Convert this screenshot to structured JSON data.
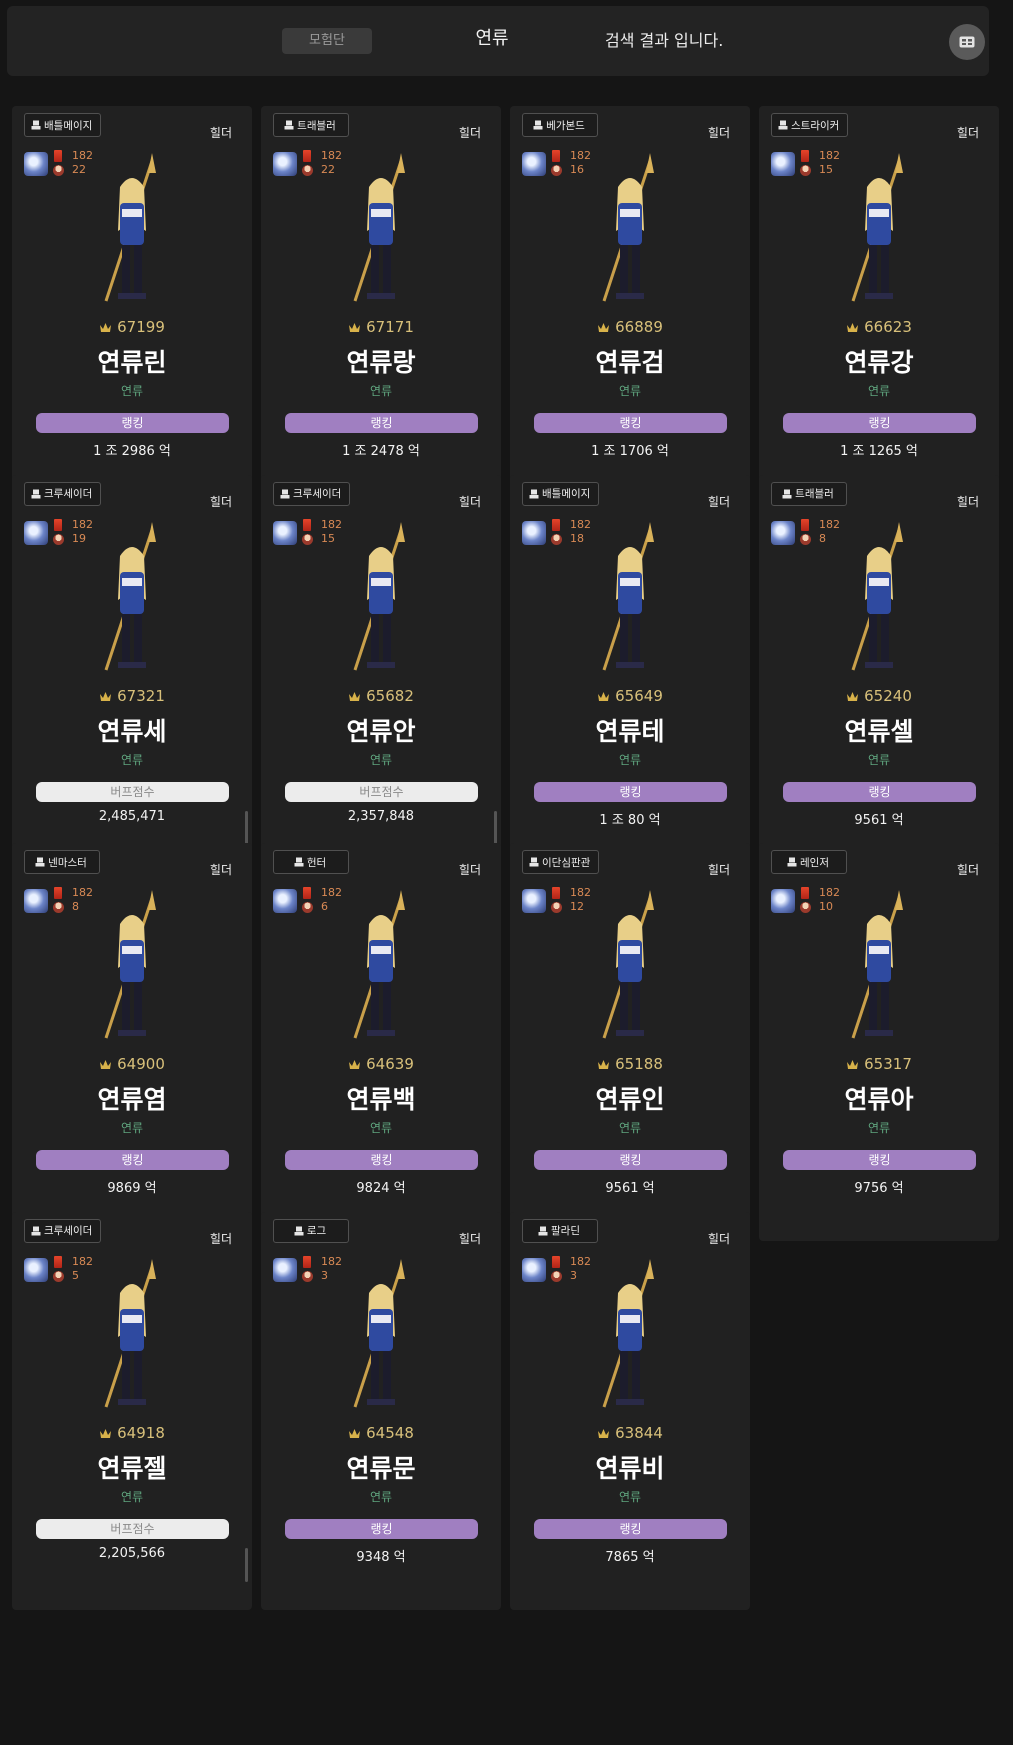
{
  "header": {
    "tab_label": "모험단",
    "search_name": "연류",
    "result_text": "검색 결과 입니다."
  },
  "colors": {
    "background": "#151515",
    "card": "#212121",
    "rank_pill": "#a07fc1",
    "buff_pill": "#ececec",
    "adventure_name": "#5fa57e",
    "fame": "#d8c07a",
    "level": "#d98a55"
  },
  "cards": [
    {
      "class_name": "배틀메이지",
      "guild": "힐더",
      "level": "182",
      "sub": "22",
      "fame": "67199",
      "name": "연류린",
      "adventure": "연류",
      "pill_type": "rank",
      "pill_label": "랭킹",
      "stat": "1 조 2986 억"
    },
    {
      "class_name": "트래블러",
      "guild": "힐더",
      "level": "182",
      "sub": "22",
      "fame": "67171",
      "name": "연류랑",
      "adventure": "연류",
      "pill_type": "rank",
      "pill_label": "랭킹",
      "stat": "1 조 2478 억"
    },
    {
      "class_name": "베가본드",
      "guild": "힐더",
      "level": "182",
      "sub": "16",
      "fame": "66889",
      "name": "연류검",
      "adventure": "연류",
      "pill_type": "rank",
      "pill_label": "랭킹",
      "stat": "1 조 1706 억"
    },
    {
      "class_name": "스트라이커",
      "guild": "힐더",
      "level": "182",
      "sub": "15",
      "fame": "66623",
      "name": "연류강",
      "adventure": "연류",
      "pill_type": "rank",
      "pill_label": "랭킹",
      "stat": "1 조 1265 억"
    },
    {
      "class_name": "크루세이더",
      "guild": "힐더",
      "level": "182",
      "sub": "19",
      "fame": "67321",
      "name": "연류세",
      "adventure": "연류",
      "pill_type": "buff",
      "pill_label": "버프점수",
      "stat": "2,485,471"
    },
    {
      "class_name": "크루세이더",
      "guild": "힐더",
      "level": "182",
      "sub": "15",
      "fame": "65682",
      "name": "연류안",
      "adventure": "연류",
      "pill_type": "buff",
      "pill_label": "버프점수",
      "stat": "2,357,848"
    },
    {
      "class_name": "배틀메이지",
      "guild": "힐더",
      "level": "182",
      "sub": "18",
      "fame": "65649",
      "name": "연류테",
      "adventure": "연류",
      "pill_type": "rank",
      "pill_label": "랭킹",
      "stat": "1 조 80 억"
    },
    {
      "class_name": "트래블러",
      "guild": "힐더",
      "level": "182",
      "sub": "8",
      "fame": "65240",
      "name": "연류셀",
      "adventure": "연류",
      "pill_type": "rank",
      "pill_label": "랭킹",
      "stat": "9561 억"
    },
    {
      "class_name": "넨마스터",
      "guild": "힐더",
      "level": "182",
      "sub": "8",
      "fame": "64900",
      "name": "연류염",
      "adventure": "연류",
      "pill_type": "rank",
      "pill_label": "랭킹",
      "stat": "9869 억"
    },
    {
      "class_name": "헌터",
      "guild": "힐더",
      "level": "182",
      "sub": "6",
      "fame": "64639",
      "name": "연류백",
      "adventure": "연류",
      "pill_type": "rank",
      "pill_label": "랭킹",
      "stat": "9824 억"
    },
    {
      "class_name": "이단심판관",
      "guild": "힐더",
      "level": "182",
      "sub": "12",
      "fame": "65188",
      "name": "연류인",
      "adventure": "연류",
      "pill_type": "rank",
      "pill_label": "랭킹",
      "stat": "9561 억"
    },
    {
      "class_name": "레인저",
      "guild": "힐더",
      "level": "182",
      "sub": "10",
      "fame": "65317",
      "name": "연류아",
      "adventure": "연류",
      "pill_type": "rank",
      "pill_label": "랭킹",
      "stat": "9756 억"
    },
    {
      "class_name": "크루세이더",
      "guild": "힐더",
      "level": "182",
      "sub": "5",
      "fame": "64918",
      "name": "연류젤",
      "adventure": "연류",
      "pill_type": "buff",
      "pill_label": "버프점수",
      "stat": "2,205,566"
    },
    {
      "class_name": "로그",
      "guild": "힐더",
      "level": "182",
      "sub": "3",
      "fame": "64548",
      "name": "연류문",
      "adventure": "연류",
      "pill_type": "rank",
      "pill_label": "랭킹",
      "stat": "9348 억"
    },
    {
      "class_name": "팔라딘",
      "guild": "힐더",
      "level": "182",
      "sub": "3",
      "fame": "63844",
      "name": "연류비",
      "adventure": "연류",
      "pill_type": "rank",
      "pill_label": "랭킹",
      "stat": "7865 억"
    }
  ]
}
